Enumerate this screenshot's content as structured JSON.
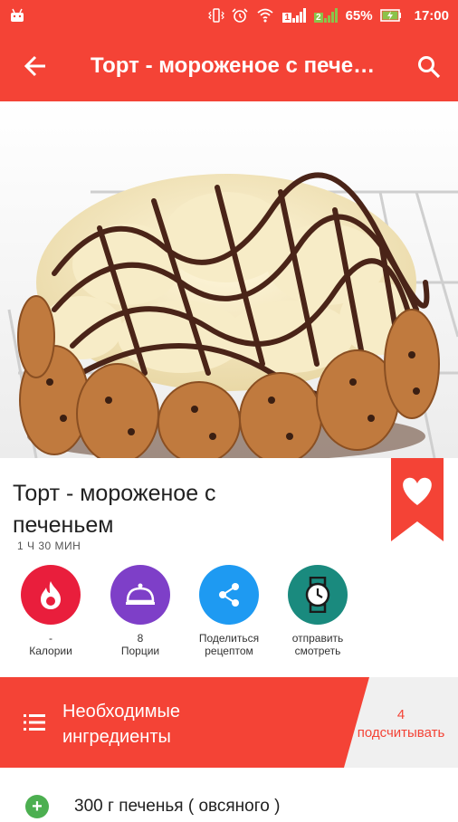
{
  "statusbar": {
    "battery": "65%",
    "time": "17:00",
    "sim1": "1",
    "sim2": "2"
  },
  "toolbar": {
    "title": "Торт - мороженое с печеньем"
  },
  "recipe": {
    "title": "Торт - мороженое с печеньем",
    "duration": "1 Ч 30 МИН"
  },
  "actions": [
    {
      "value": "-",
      "label": "Калории",
      "color": "#e91e3c",
      "icon": "flame-icon"
    },
    {
      "value": "8",
      "label": "Порции",
      "color": "#7e3fc8",
      "icon": "cloche-icon"
    },
    {
      "value": "Поделиться",
      "label": "рецептом",
      "color": "#1e9af2",
      "icon": "share-icon"
    },
    {
      "value": "отправить",
      "label": "смотреть",
      "color": "#1a8a7e",
      "icon": "watch-icon"
    }
  ],
  "ingredients": {
    "header": "Необходимые ингредиенты",
    "count": "4",
    "count_label": "подсчитывать",
    "items": [
      "300 г печенья ( овсяного )"
    ]
  },
  "colors": {
    "primary": "#f44336"
  }
}
